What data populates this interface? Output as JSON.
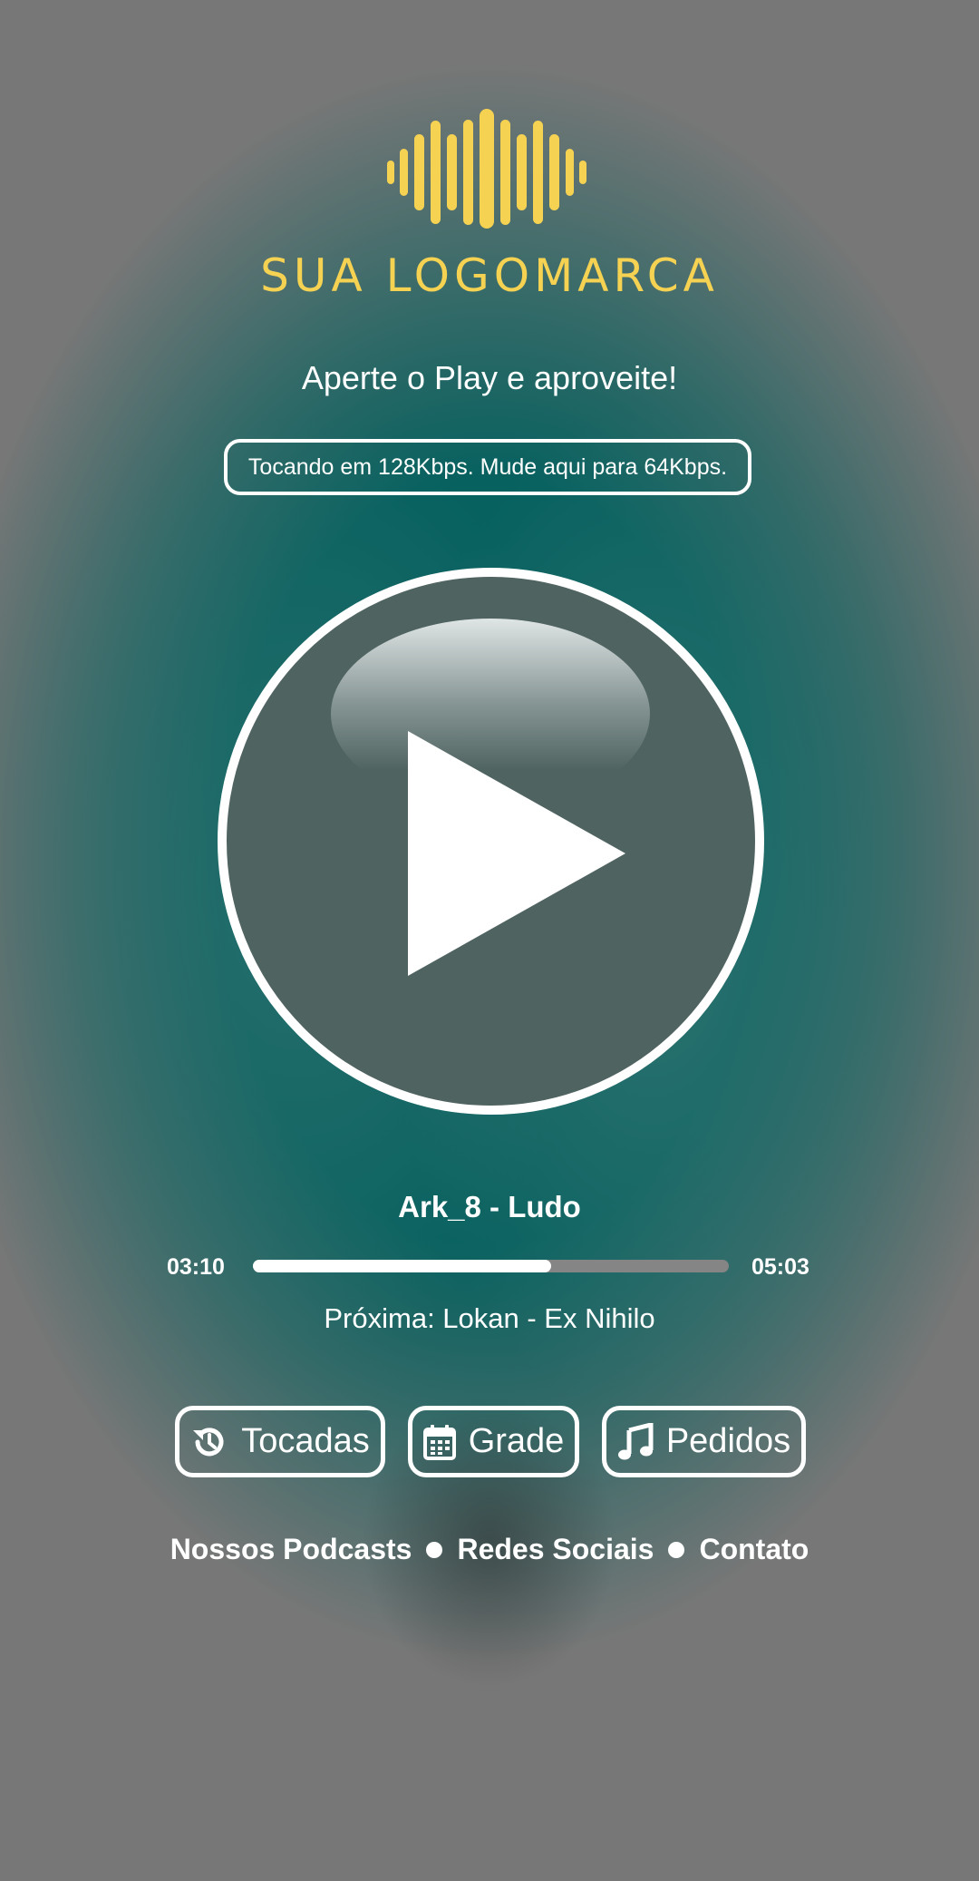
{
  "brand": {
    "logo_text": "SUA LOGOMARCA",
    "logo_icon": "soundwave-icon",
    "accent_color": "#f6d253"
  },
  "tagline": "Aperte o Play e aproveite!",
  "quality_button": "Tocando em 128Kbps. Mude aqui para 64Kbps.",
  "player": {
    "play_icon": "play-icon",
    "now_playing": "Ark_8 - Ludo",
    "elapsed": "03:10",
    "duration": "05:03",
    "progress_fraction": 0.627,
    "next": "Próxima: Lokan - Ex Nihilo"
  },
  "nav_buttons": [
    {
      "label": "Tocadas",
      "icon": "history-icon"
    },
    {
      "label": "Grade",
      "icon": "calendar-icon"
    },
    {
      "label": "Pedidos",
      "icon": "music-note-icon"
    }
  ],
  "footer_links": [
    {
      "label": "Nossos Podcasts"
    },
    {
      "label": "Redes Sociais"
    },
    {
      "label": "Contato"
    }
  ]
}
